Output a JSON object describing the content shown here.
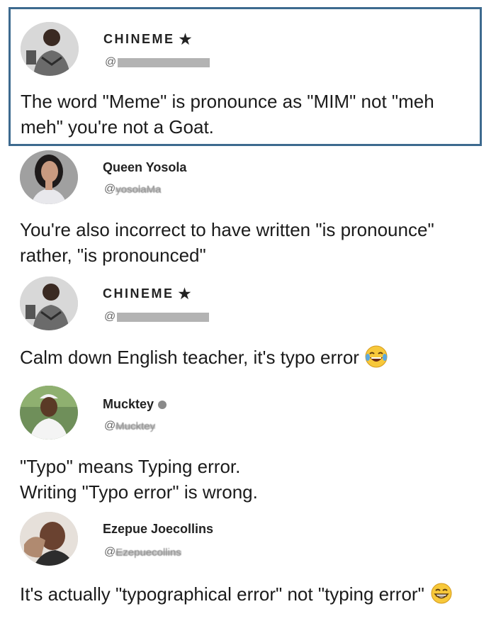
{
  "posts": [
    {
      "name": "CHINEME",
      "star": "★",
      "handle_prefix": "@",
      "text": "The word \"Meme\" is pronounce as \"MIM\" not \"meh meh\" you're not a Goat.",
      "avatar_icon": "man-avatar-icon"
    },
    {
      "name": "Queen Yosola",
      "handle_prefix": "@",
      "handle_rest": "yosolaMa",
      "text": "You're also incorrect to have written \"is pronounce\" rather, \"is pronounced\"",
      "avatar_icon": "woman-avatar-icon"
    },
    {
      "name": "CHINEME",
      "star": "★",
      "handle_prefix": "@",
      "text": "Calm down English teacher, it's typo error",
      "emoji": "tears-of-joy-emoji-icon",
      "avatar_icon": "man-avatar-icon"
    },
    {
      "name": "Mucktey",
      "handle_prefix": "@",
      "handle_rest": "Mucktey",
      "text_line1": "\"Typo\" means Typing error.",
      "text_line2": "Writing \"Typo error\" is wrong.",
      "avatar_icon": "man-white-cap-avatar-icon"
    },
    {
      "name": "Ezepue Joecollins",
      "handle_prefix": "@",
      "handle_rest": "Ezepuecollins",
      "text": "It's actually \"typographical error\" not \"typing error\"",
      "emoji": "grinning-emoji-icon",
      "avatar_icon": "man-selfie-avatar-icon"
    }
  ],
  "colors": {
    "highlight_border": "#3d6a8f",
    "text": "#1b1b1b",
    "handle": "#666666",
    "redaction": "#b3b3b3",
    "online_dot": "#8a8a8a"
  }
}
